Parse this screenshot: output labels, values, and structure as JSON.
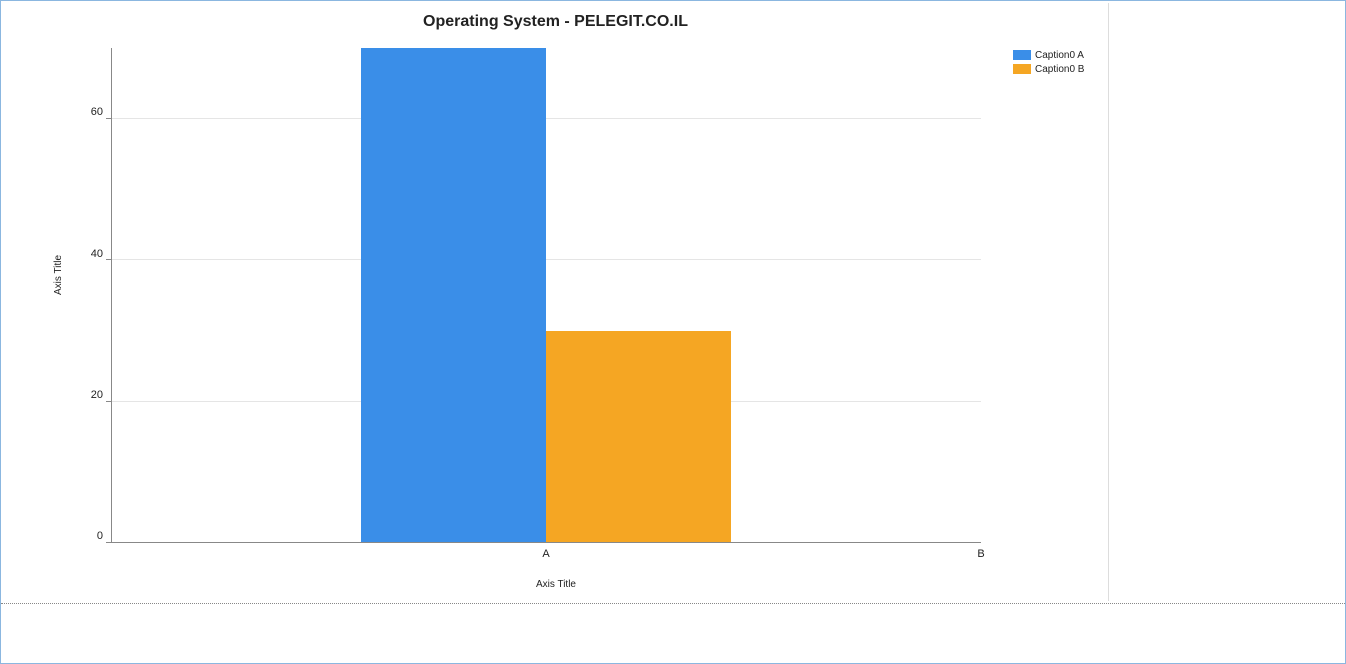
{
  "chart_data": {
    "type": "bar",
    "title": "Operating System - PELEGIT.CO.IL",
    "xlabel": "Axis Title",
    "ylabel": "Axis Title",
    "ylim": [
      0,
      70
    ],
    "y_ticks": [
      0,
      20,
      40,
      60
    ],
    "categories": [
      "A",
      "B"
    ],
    "series": [
      {
        "name": "Caption0 A",
        "values": [
          73,
          0
        ],
        "color": "#3a8ee8"
      },
      {
        "name": "Caption0 B",
        "values": [
          30,
          0
        ],
        "color": "#f5a623"
      }
    ],
    "legend_position": "right"
  }
}
